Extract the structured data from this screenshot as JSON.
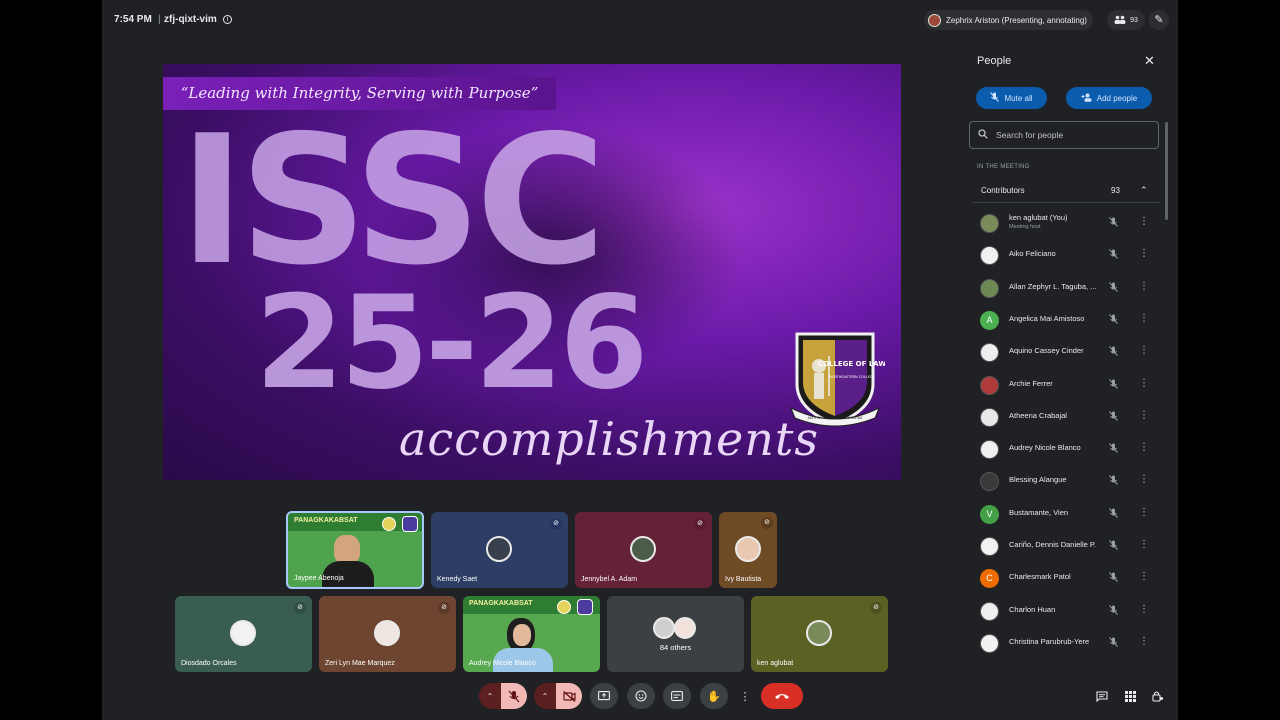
{
  "topbar": {
    "time": "7:54 PM",
    "separator": "|",
    "meeting_code": "zfj-qixt-vim",
    "presenter": "Zephrix Ariston (Presenting, annotating)",
    "participant_count": "93"
  },
  "slide": {
    "motto": "“Leading with Integrity, Serving with Purpose”",
    "title": "ISSC",
    "year": "25-26",
    "subtitle": "accomplishments",
    "seal_text_top": "COLLEGE OF LAW",
    "seal_text_bottom": "NORTHEASTERN COLLEGE",
    "seal_ribbon": "JUSTITIA · VERITAS · INTEGRITAS"
  },
  "tiles": {
    "row1": [
      {
        "name": "Jaypee Abenoja",
        "banner": "PANAGKAKABSAT"
      },
      {
        "name": "Kenedy Saet"
      },
      {
        "name": "Jennybel A. Adam"
      },
      {
        "name": "Ivy Bautista"
      }
    ],
    "row2": [
      {
        "name": "Diosdado Orcales"
      },
      {
        "name": "Zeri Lyn Mae Marquez"
      },
      {
        "name": "Audrey Nicole Blanco",
        "banner": "PANAGKAKABSAT"
      },
      {
        "name": "84 others"
      },
      {
        "name": "ken aglubat"
      }
    ]
  },
  "panel": {
    "title": "People",
    "mute_all": "Mute all",
    "add_people": "Add people",
    "search_placeholder": "Search for people",
    "in_meeting": "IN THE MEETING",
    "contributors_label": "Contributors",
    "contributors_count": "93",
    "participants": [
      {
        "name": "ken aglubat (You)",
        "sub": "Meeting host",
        "avatar": "photo",
        "color": "#7a8b5a"
      },
      {
        "name": "Aiko Feliciano",
        "avatar": "photo",
        "color": "#f1f1f1"
      },
      {
        "name": "Allan Zephyr L. Taguba, ...",
        "avatar": "photo",
        "color": "#6d8a55"
      },
      {
        "name": "Angelica Mai Amistoso",
        "avatar": "A",
        "color": "#4caf50"
      },
      {
        "name": "Aquino Cassey Cinder",
        "avatar": "photo",
        "color": "#eeeeee"
      },
      {
        "name": "Archie Ferrer",
        "avatar": "photo",
        "color": "#b03a3a"
      },
      {
        "name": "Atheena Crabajal",
        "avatar": "photo",
        "color": "#e9e9e9"
      },
      {
        "name": "Audrey Nicole Blanco",
        "avatar": "photo",
        "color": "#f0f0f0"
      },
      {
        "name": "Blessing Alangue",
        "avatar": "photo",
        "color": "#3a3a3a"
      },
      {
        "name": "Bustamante, Vien",
        "avatar": "V",
        "color": "#43a047"
      },
      {
        "name": "Cariño, Dennis Danielle P.",
        "avatar": "photo",
        "color": "#f2f2f2"
      },
      {
        "name": "Charlesmark Patol",
        "avatar": "C",
        "color": "#ef6c00"
      },
      {
        "name": "Charlon Huan",
        "avatar": "photo",
        "color": "#eeeeee"
      },
      {
        "name": "Christina Parubrub-Yere",
        "avatar": "photo",
        "color": "#f1f1f1"
      }
    ]
  },
  "controls": {
    "mic": "muted",
    "camera": "off",
    "icons": [
      "present-icon",
      "emoji-icon",
      "captions-icon",
      "raise-hand-icon",
      "more-icon",
      "hangup-icon"
    ]
  },
  "colors": {
    "background": "#202124",
    "accent_blue": "#0b5cad",
    "hangup_red": "#d93025",
    "slide_purple": "#6a1aa8"
  }
}
